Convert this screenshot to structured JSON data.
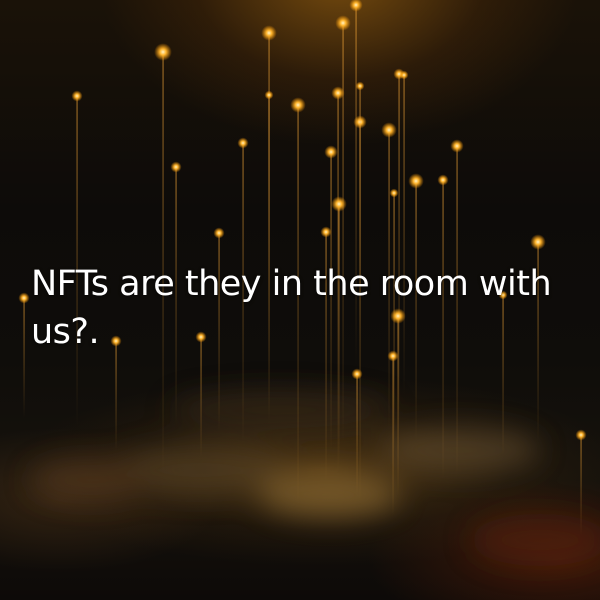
{
  "post": {
    "headline": "NFTs are they in the room with us?."
  },
  "colors": {
    "background": "#0b0a09",
    "glow": "#ffb52e",
    "text": "#ffffff"
  }
}
